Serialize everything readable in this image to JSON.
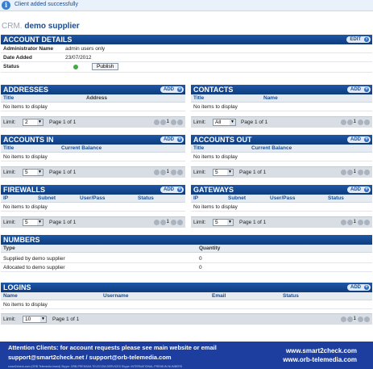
{
  "notice": {
    "message": "Client added successfully",
    "icon": "info-icon"
  },
  "crm": {
    "prefix": "CRM.",
    "title": "demo supplier"
  },
  "account_details": {
    "title": "ACCOUNT DETAILS",
    "edit_label": "EDIT",
    "rows": [
      {
        "label": "Administrator Name",
        "value": "admin users only"
      },
      {
        "label": "Date Added",
        "value": "23/07/2012"
      }
    ],
    "status_label": "Status",
    "publish_label": "Publish"
  },
  "add_label": "ADD",
  "no_items": "No items to display",
  "limit_label": "Limit:",
  "page_text": "Page 1 of 1",
  "pager_number": "1",
  "addresses": {
    "title": "ADDRESSES",
    "cols": [
      "Title",
      "Address"
    ],
    "limit": "2"
  },
  "contacts": {
    "title": "CONTACTS",
    "cols": [
      "Title",
      "Name"
    ],
    "limit": "All"
  },
  "accounts_in": {
    "title": "ACCOUNTS IN",
    "cols": [
      "Title",
      "Current Balance"
    ],
    "limit": "5"
  },
  "accounts_out": {
    "title": "ACCOUNTS OUT",
    "cols": [
      "Title",
      "Current Balance"
    ],
    "limit": "5"
  },
  "firewalls": {
    "title": "FIREWALLS",
    "cols": [
      "IP",
      "Subnet",
      "User/Pass",
      "Status"
    ],
    "limit": "5"
  },
  "gateways": {
    "title": "GATEWAYS",
    "cols": [
      "IP",
      "Subnet",
      "User/Pass",
      "Status"
    ],
    "limit": "5"
  },
  "numbers": {
    "title": "NUMBERS",
    "cols": [
      "Type",
      "Quantity"
    ],
    "rows": [
      {
        "type": "Supplied by demo supplier",
        "qty": "0"
      },
      {
        "type": "Allocated to demo supplier",
        "qty": "0"
      }
    ]
  },
  "logins": {
    "title": "LOGINS",
    "cols": [
      "Name",
      "Username",
      "Email",
      "Status"
    ],
    "limit": "10"
  },
  "footer": {
    "line1": "Attention Clients: for account requests please see main website or email",
    "line2": "support@smart2check.net   /  support@orb-telemedia.com",
    "site1": "www.smart2check.com",
    "site2": "www.orb-telemedia.com",
    "fine": "smart2check.com (ORB Telemedia brand)    Skype: ORB-PREMIUM-TELECOM-SERVICES    Skype: INTERNATIONAL.PREMIUM.NUMBERS"
  },
  "colors": {
    "header": "#1d57a8",
    "footer": "#1d3e9e",
    "accent": "#1b4b8c"
  }
}
